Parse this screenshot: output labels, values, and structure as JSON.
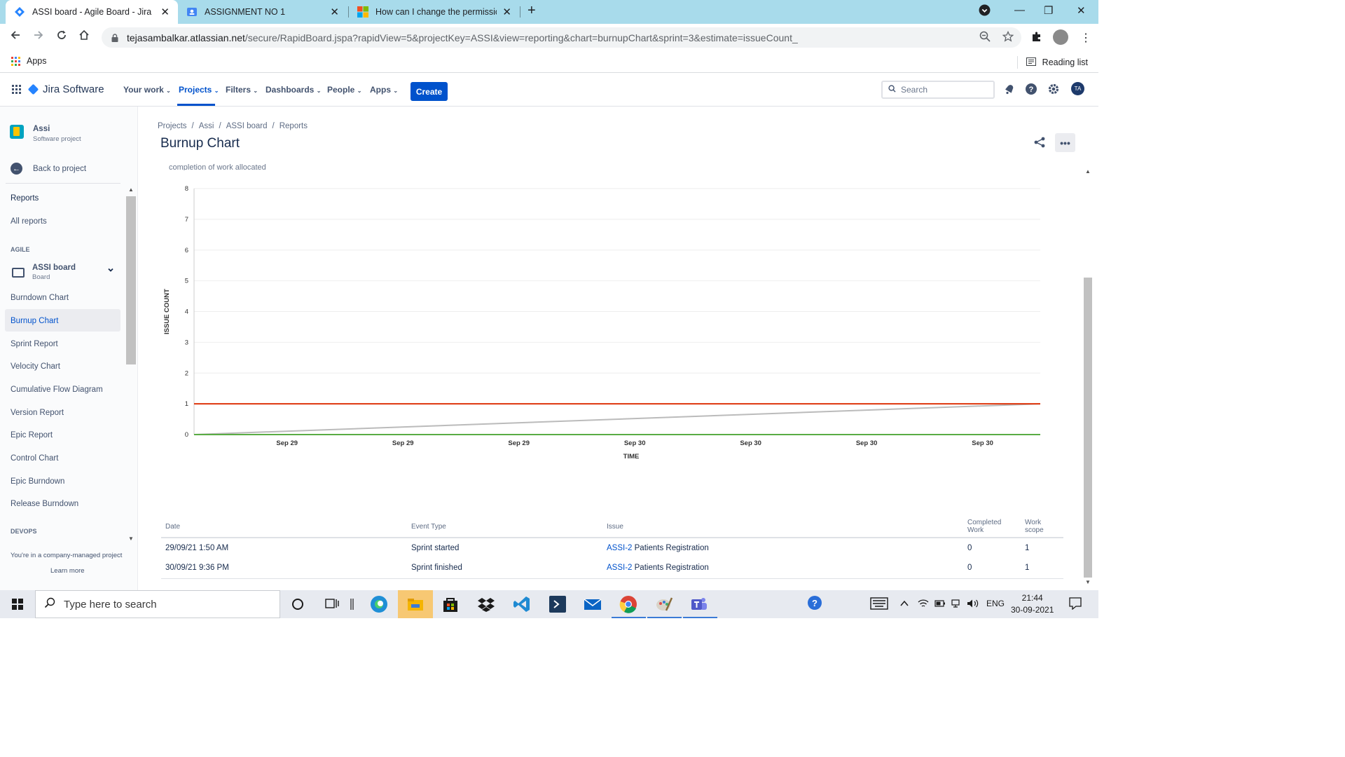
{
  "browser": {
    "tabs": [
      {
        "title": "ASSI board - Agile Board - Jira",
        "active": true,
        "icon": "jira-diamond-icon"
      },
      {
        "title": "ASSIGNMENT NO 1",
        "active": false,
        "icon": "classroom-icon"
      },
      {
        "title": "How can I change the permission",
        "active": false,
        "icon": "microsoft-icon"
      }
    ],
    "url_host": "tejasambalkar.atlassian.net",
    "url_path": "/secure/RapidBoard.jspa?rapidView=5&projectKey=ASSI&view=reporting&chart=burnupChart&sprint=3&estimate=issueCount_",
    "bookmark_apps": "Apps",
    "reading_list": "Reading list"
  },
  "jira_nav": {
    "product": "Jira Software",
    "menus": [
      {
        "label": "Your work"
      },
      {
        "label": "Projects"
      },
      {
        "label": "Filters"
      },
      {
        "label": "Dashboards"
      },
      {
        "label": "People"
      },
      {
        "label": "Apps"
      }
    ],
    "active_menu": "Projects",
    "create_label": "Create",
    "search_placeholder": "Search",
    "avatar_initials": "TA"
  },
  "sidebar": {
    "project_name": "Assi",
    "project_type": "Software project",
    "back_label": "Back to project",
    "reports_heading": "Reports",
    "all_reports": "All reports",
    "agile_section": "AGILE",
    "board_name": "ASSI board",
    "board_type": "Board",
    "reports": [
      {
        "label": "Burndown Chart"
      },
      {
        "label": "Burnup Chart"
      },
      {
        "label": "Sprint Report"
      },
      {
        "label": "Velocity Chart"
      },
      {
        "label": "Cumulative Flow Diagram"
      },
      {
        "label": "Version Report"
      },
      {
        "label": "Epic Report"
      },
      {
        "label": "Control Chart"
      },
      {
        "label": "Epic Burndown"
      },
      {
        "label": "Release Burndown"
      }
    ],
    "active_report": "Burnup Chart",
    "devops_section": "DEVOPS",
    "footer_text": "You're in a company-managed project",
    "learn_more": "Learn more"
  },
  "main": {
    "breadcrumb": [
      "Projects",
      "Assi",
      "ASSI board",
      "Reports"
    ],
    "title": "Burnup Chart",
    "subtitle": "completion of work allocated"
  },
  "chart_data": {
    "type": "line",
    "xlabel": "TIME",
    "ylabel": "ISSUE COUNT",
    "ylim": [
      0,
      8
    ],
    "yticks": [
      0,
      1,
      2,
      3,
      4,
      5,
      6,
      7,
      8
    ],
    "xticks": [
      "Sep 29",
      "Sep 29",
      "Sep 29",
      "Sep 30",
      "Sep 30",
      "Sep 30",
      "Sep 30"
    ],
    "series": [
      {
        "name": "",
        "color": "#de350b",
        "points": [
          [
            0,
            1
          ],
          [
            1,
            1
          ]
        ]
      },
      {
        "name": "",
        "color": "#bbbbbb",
        "points": [
          [
            0,
            0
          ],
          [
            1,
            1
          ]
        ]
      },
      {
        "name": "",
        "color": "#5aac44",
        "points": [
          [
            0,
            0
          ],
          [
            1,
            0
          ]
        ]
      }
    ],
    "grid": true
  },
  "events_table": {
    "headers": [
      "Date",
      "Event Type",
      "Issue",
      "Completed Work",
      "Work scope"
    ],
    "rows": [
      {
        "date": "29/09/21 1:50 AM",
        "event": "Sprint started",
        "issue_key": "ASSI-2",
        "issue_title": "Patients Registration",
        "completed": "0",
        "scope": "1"
      },
      {
        "date": "30/09/21 9:36 PM",
        "event": "Sprint finished",
        "issue_key": "ASSI-2",
        "issue_title": "Patients Registration",
        "completed": "0",
        "scope": "1"
      }
    ]
  },
  "taskbar": {
    "search_placeholder": "Type here to search",
    "language": "ENG",
    "time": "21:44",
    "date": "30-09-2021"
  }
}
